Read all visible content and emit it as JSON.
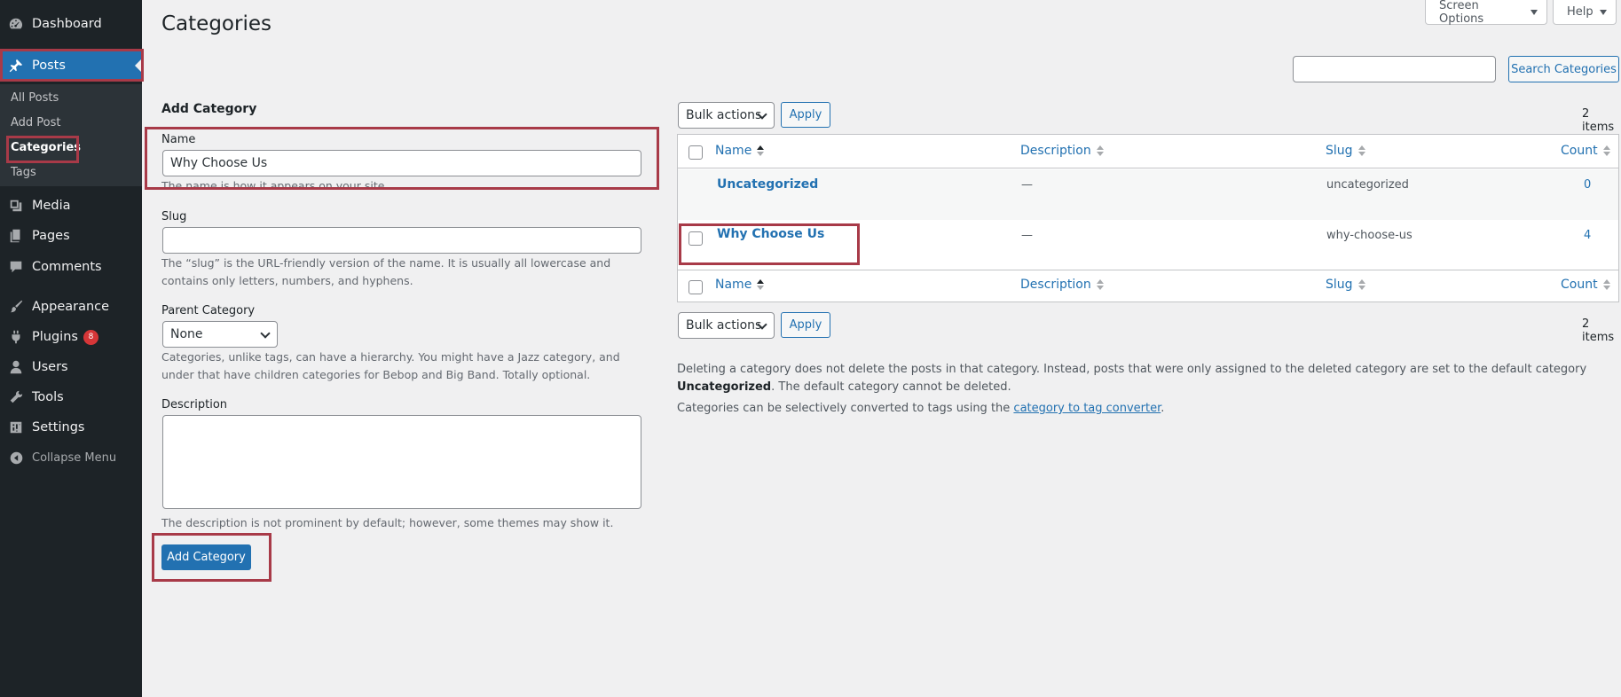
{
  "sidebar": {
    "items": [
      {
        "label": "Dashboard",
        "icon": "dashboard-icon"
      },
      {
        "label": "Posts",
        "icon": "pin-icon"
      },
      {
        "label": "Media",
        "icon": "media-icon"
      },
      {
        "label": "Pages",
        "icon": "pages-icon"
      },
      {
        "label": "Comments",
        "icon": "comment-icon"
      },
      {
        "label": "Appearance",
        "icon": "brush-icon"
      },
      {
        "label": "Plugins",
        "icon": "plugin-icon",
        "badge": "8"
      },
      {
        "label": "Users",
        "icon": "user-icon"
      },
      {
        "label": "Tools",
        "icon": "wrench-icon"
      },
      {
        "label": "Settings",
        "icon": "settings-icon"
      }
    ],
    "submenu": [
      "All Posts",
      "Add Post",
      "Categories",
      "Tags"
    ],
    "collapse_label": "Collapse Menu"
  },
  "top": {
    "screen_options": "Screen Options",
    "help": "Help"
  },
  "page_title": "Categories",
  "form": {
    "heading": "Add Category",
    "name_label": "Name",
    "name_value": "Why Choose Us",
    "name_help": "The name is how it appears on your site.",
    "slug_label": "Slug",
    "slug_value": "",
    "slug_help": "The “slug” is the URL-friendly version of the name. It is usually all lowercase and contains only letters, numbers, and hyphens.",
    "parent_label": "Parent Category",
    "parent_value": "None",
    "parent_help": "Categories, unlike tags, can have a hierarchy. You might have a Jazz category, and under that have children categories for Bebop and Big Band. Totally optional.",
    "description_label": "Description",
    "description_help": "The description is not prominent by default; however, some themes may show it.",
    "submit": "Add Category"
  },
  "list": {
    "search_button": "Search Categories",
    "bulk_actions": "Bulk actions",
    "apply": "Apply",
    "items_count": "2 items",
    "columns": [
      "Name",
      "Description",
      "Slug",
      "Count"
    ],
    "rows": [
      {
        "name": "Uncategorized",
        "description": "—",
        "slug": "uncategorized",
        "count": "0"
      },
      {
        "name": "Why Choose Us",
        "description": "—",
        "slug": "why-choose-us",
        "count": "4"
      }
    ],
    "note1_a": "Deleting a category does not delete the posts in that category. Instead, posts that were only assigned to the deleted category are set to the default category ",
    "note1_b": "Uncategorized",
    "note1_c": ". The default category cannot be deleted.",
    "note2_a": "Categories can be selectively converted to tags using the ",
    "note2_link": "category to tag converter",
    "note2_b": "."
  },
  "colors": {
    "sidebar_bg": "#1d2327",
    "accent": "#2271b1",
    "highlight": "#a83a48",
    "badge": "#d63638"
  }
}
